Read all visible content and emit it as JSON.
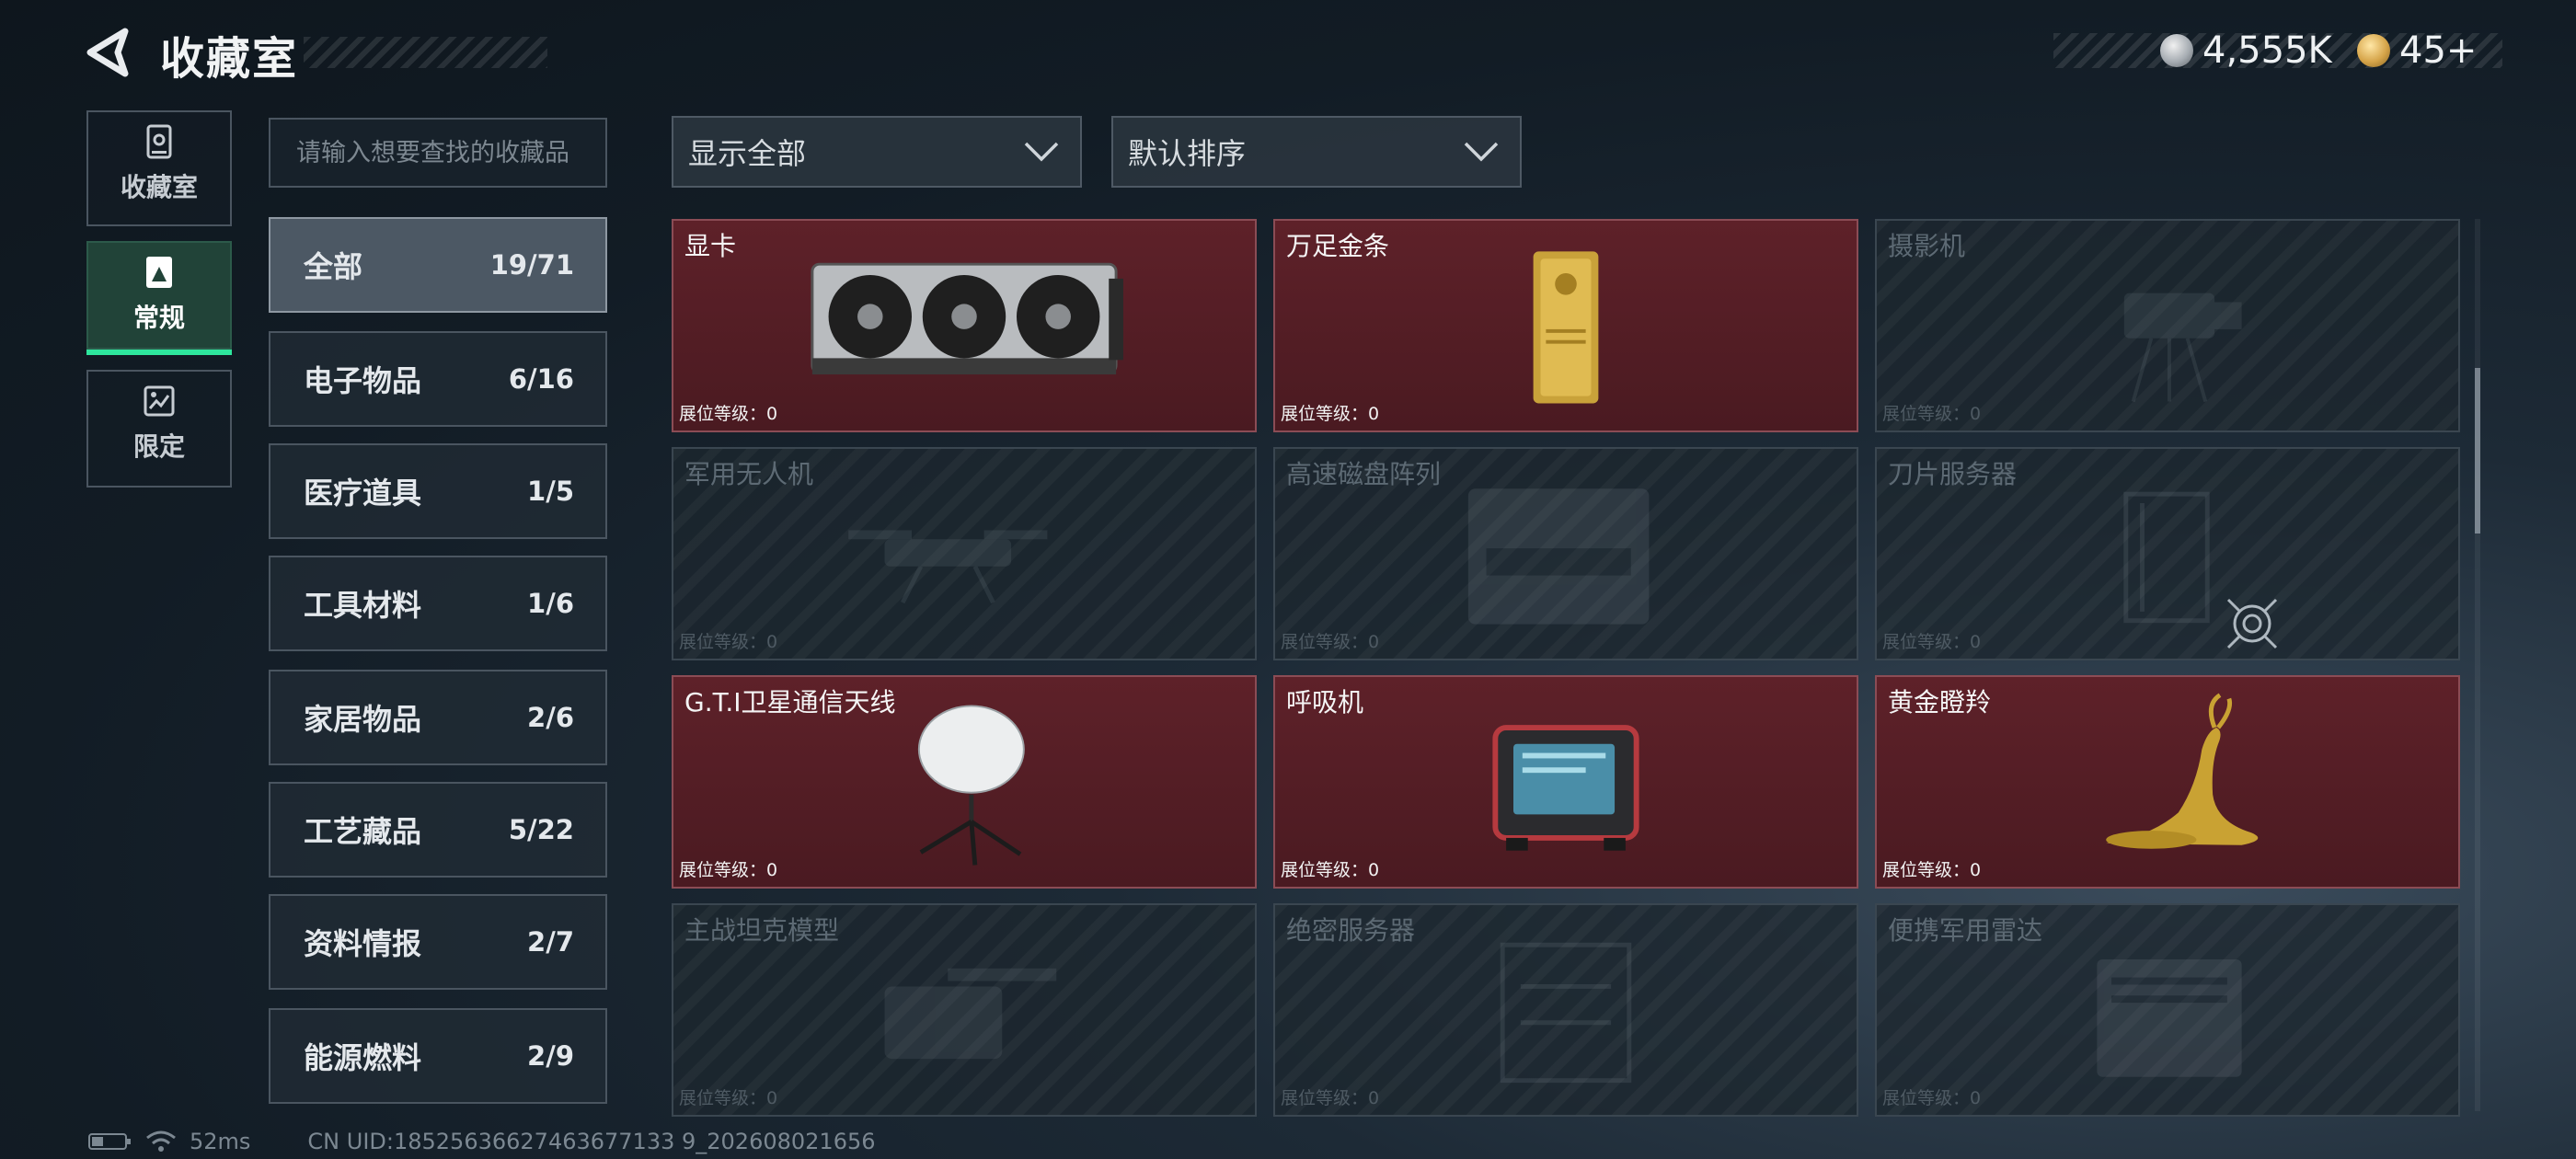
{
  "header": {
    "title": "收藏室",
    "currencies": [
      {
        "icon": "silver-coin-icon",
        "value": "4,555K"
      },
      {
        "icon": "gold-coin-icon",
        "value": "45+"
      }
    ]
  },
  "nav": [
    {
      "icon": "vault-icon",
      "label": "收藏室",
      "active": false
    },
    {
      "icon": "image-card-icon",
      "label": "常规",
      "active": true
    },
    {
      "icon": "limited-image-icon",
      "label": "限定",
      "active": false
    }
  ],
  "search": {
    "placeholder": "请输入想要查找的收藏品",
    "value": ""
  },
  "categories": [
    {
      "name": "全部",
      "count": "19/71",
      "active": true
    },
    {
      "name": "电子物品",
      "count": "6/16"
    },
    {
      "name": "医疗道具",
      "count": "1/5"
    },
    {
      "name": "工具材料",
      "count": "1/6"
    },
    {
      "name": "家居物品",
      "count": "2/6"
    },
    {
      "name": "工艺藏品",
      "count": "5/22"
    },
    {
      "name": "资料情报",
      "count": "2/7"
    },
    {
      "name": "能源燃料",
      "count": "2/9"
    }
  ],
  "filters": {
    "display": "显示全部",
    "sort": "默认排序"
  },
  "items": [
    {
      "name": "显卡",
      "level": "展位等级：0",
      "owned": true,
      "icon": "graphics-card-icon"
    },
    {
      "name": "万足金条",
      "level": "展位等级：0",
      "owned": true,
      "icon": "gold-bar-icon"
    },
    {
      "name": "摄影机",
      "level": "展位等级：0",
      "owned": false,
      "icon": "camera-icon"
    },
    {
      "name": "军用无人机",
      "level": "展位等级：0",
      "owned": false,
      "icon": "drone-icon"
    },
    {
      "name": "高速磁盘阵列",
      "level": "展位等级：0",
      "owned": false,
      "icon": "disk-array-icon"
    },
    {
      "name": "刀片服务器",
      "level": "展位等级：0",
      "owned": false,
      "icon": "blade-server-icon"
    },
    {
      "name": "G.T.I卫星通信天线",
      "level": "展位等级：0",
      "owned": true,
      "icon": "satellite-antenna-icon"
    },
    {
      "name": "呼吸机",
      "level": "展位等级：0",
      "owned": true,
      "icon": "ventilator-icon"
    },
    {
      "name": "黄金瞪羚",
      "level": "展位等级：0",
      "owned": true,
      "icon": "golden-gazelle-icon"
    },
    {
      "name": "主战坦克模型",
      "level": "展位等级：0",
      "owned": false,
      "icon": "tank-model-icon"
    },
    {
      "name": "绝密服务器",
      "level": "展位等级：0",
      "owned": false,
      "icon": "secret-server-icon"
    },
    {
      "name": "便携军用雷达",
      "level": "展位等级：0",
      "owned": false,
      "icon": "portable-radar-icon"
    }
  ],
  "status": {
    "battery_icon": "battery-icon",
    "wifi_icon": "wifi-icon",
    "ping": "52ms",
    "uid": "CN UID:18525636627463677133 9_202608021656"
  }
}
